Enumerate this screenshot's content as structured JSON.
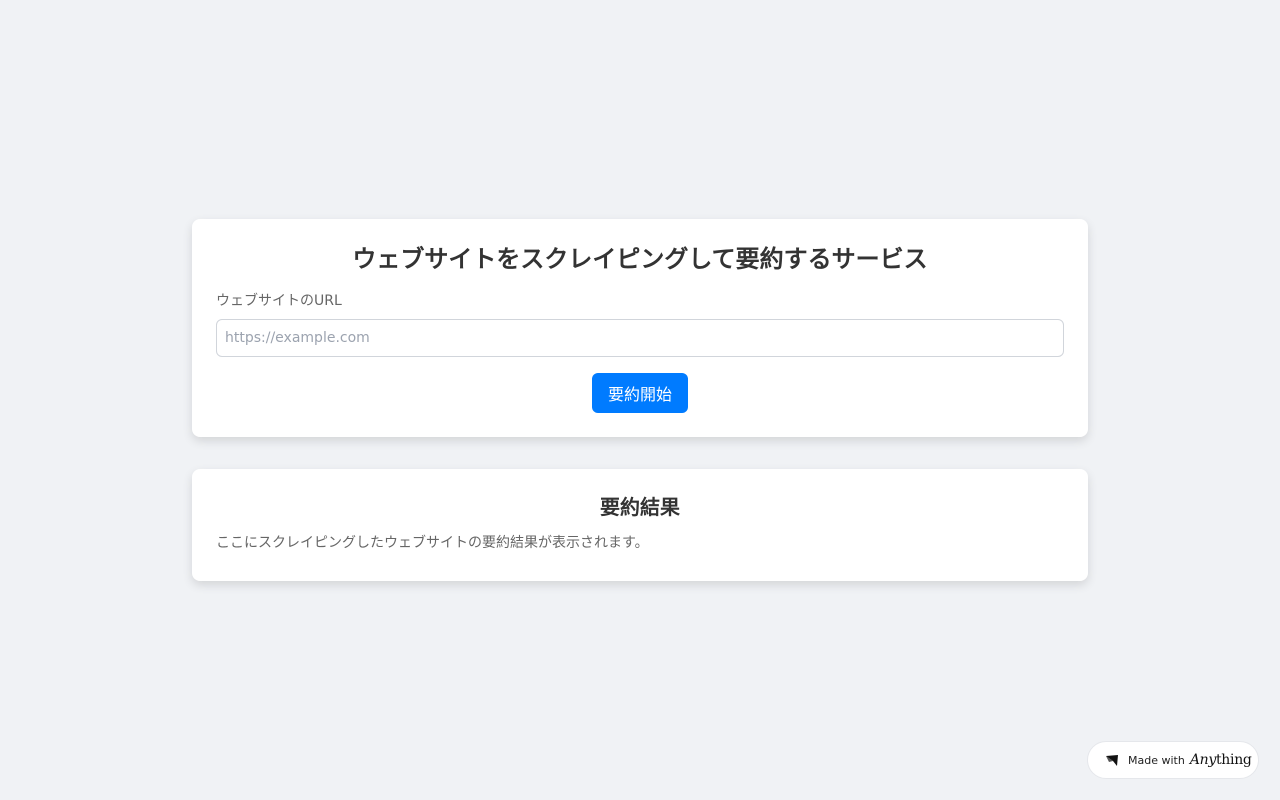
{
  "form": {
    "title": "ウェブサイトをスクレイピングして要約するサービス",
    "url_label": "ウェブサイトのURL",
    "url_value": "",
    "url_placeholder": "https://example.com",
    "submit_label": "要約開始",
    "accent_color": "#007bff"
  },
  "result": {
    "title": "要約結果",
    "text": "ここにスクレイピングしたウェブサイトの要約結果が表示されます。"
  },
  "badge": {
    "made_with": "Made with",
    "brand_italic": "Any",
    "brand_rest": "thing",
    "icon": "anything-logo-icon"
  }
}
